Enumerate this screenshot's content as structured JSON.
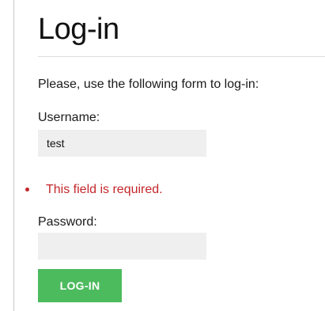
{
  "page": {
    "title": "Log-in",
    "intro": "Please, use the following form to log-in:"
  },
  "form": {
    "username": {
      "label": "Username:",
      "value": "test",
      "errors": [
        "This field is required."
      ]
    },
    "password": {
      "label": "Password:",
      "value": ""
    },
    "submit_label": "LOG-IN"
  },
  "colors": {
    "error": "#c3272b",
    "button": "#4cbb5e",
    "input_background": "#efefef"
  }
}
